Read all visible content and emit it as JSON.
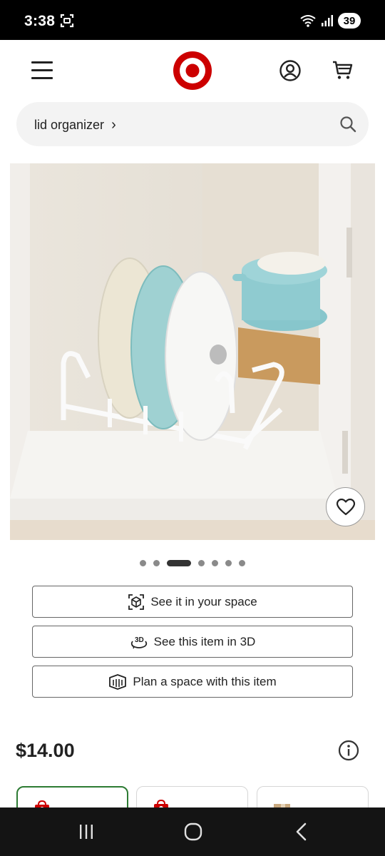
{
  "status_bar": {
    "time": "3:38",
    "battery": "39"
  },
  "header": {
    "logo": "target-bullseye-logo"
  },
  "search": {
    "query": "lid organizer",
    "chevron": "›"
  },
  "gallery": {
    "dot_count": 7,
    "active_index": 2
  },
  "actions": [
    {
      "label": "See it in your space",
      "icon": "ar-cube-icon"
    },
    {
      "label": "See this item in 3D",
      "icon": "rotate-3d-icon"
    },
    {
      "label": "Plan a space with this item",
      "icon": "room-plan-icon"
    }
  ],
  "product": {
    "price": "$14.00"
  },
  "colors": {
    "brand_red": "#cc0000",
    "selected_green": "#2d7b33",
    "nav_bg": "#141414"
  }
}
